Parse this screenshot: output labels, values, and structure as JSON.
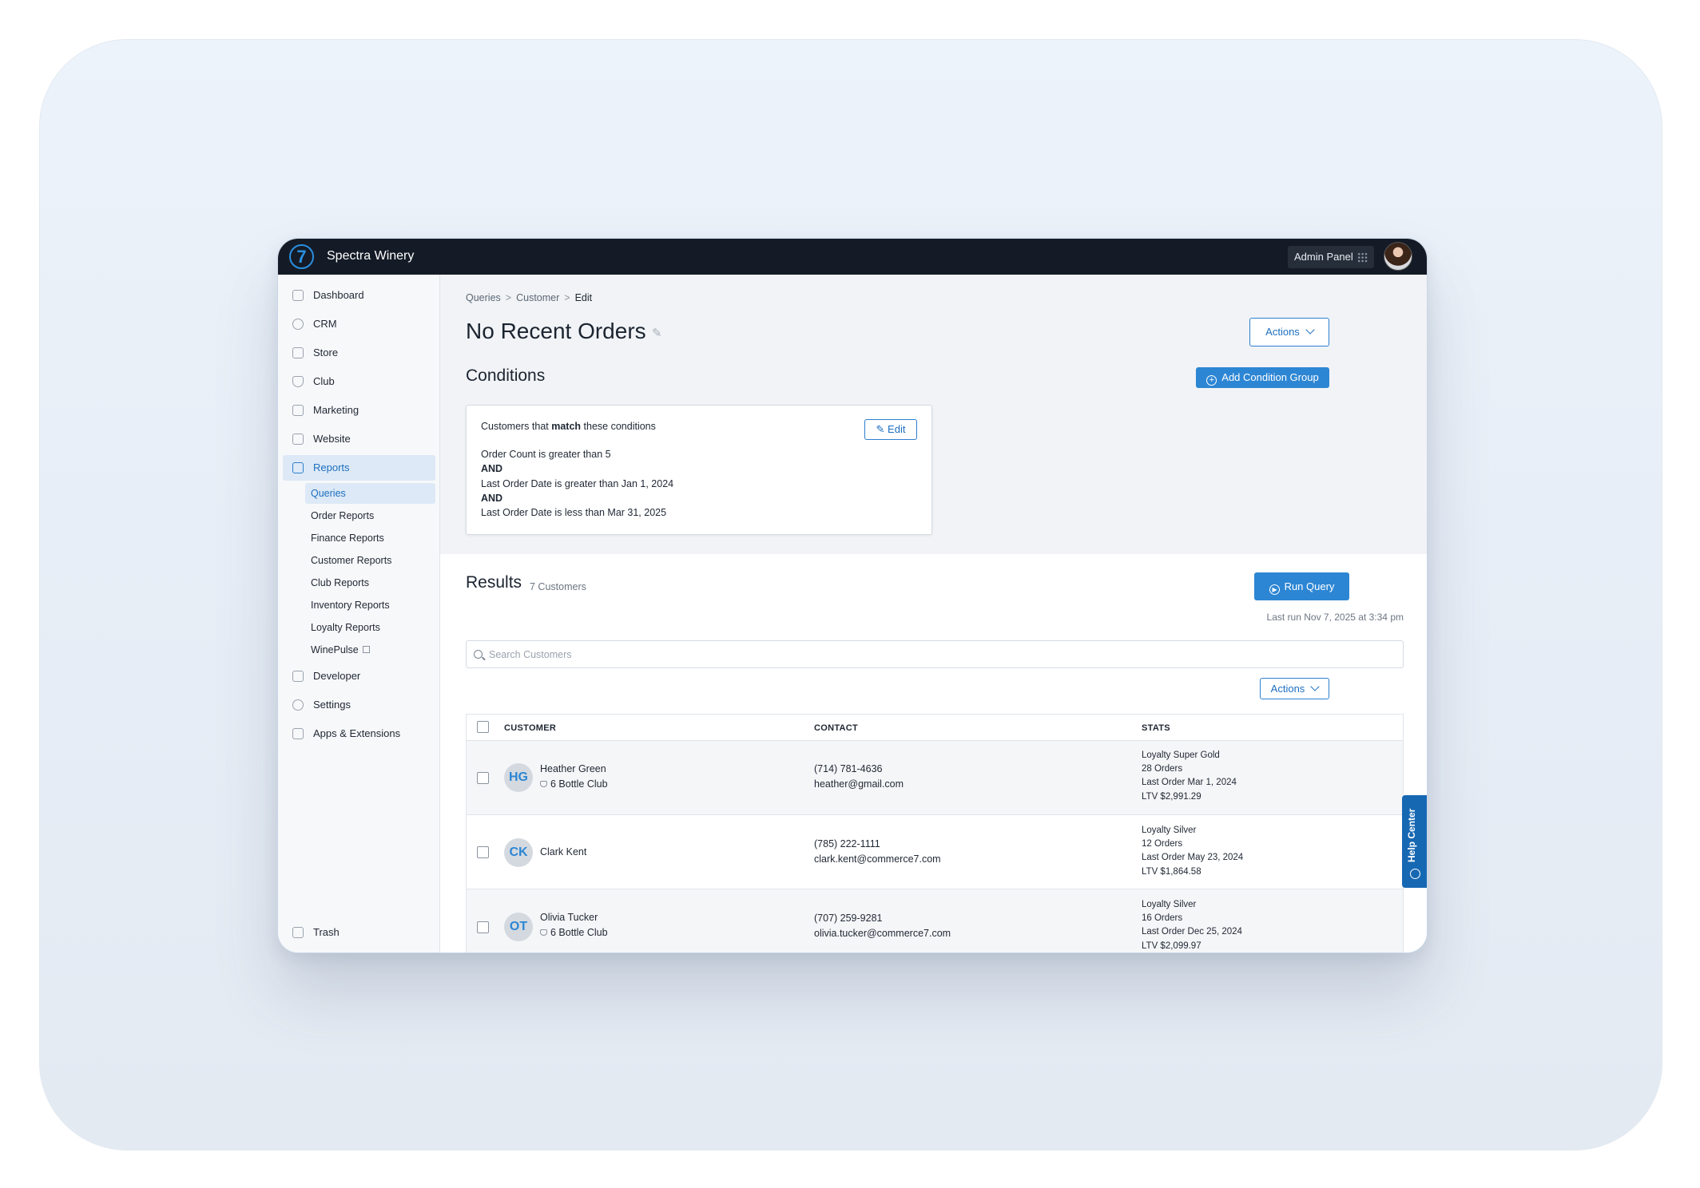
{
  "app": {
    "brand": "Spectra Winery",
    "logo_glyph": "7",
    "admin_label": "Admin Panel",
    "accent": "#2d86d4"
  },
  "sidebar": {
    "items": [
      {
        "label": "Dashboard",
        "icon": "home-icon"
      },
      {
        "label": "CRM",
        "icon": "smiley-icon"
      },
      {
        "label": "Store",
        "icon": "store-icon"
      },
      {
        "label": "Club",
        "icon": "diamond-icon"
      },
      {
        "label": "Marketing",
        "icon": "megaphone-icon"
      },
      {
        "label": "Website",
        "icon": "monitor-icon"
      },
      {
        "label": "Reports",
        "icon": "bar-chart-icon"
      },
      {
        "label": "Developer",
        "icon": "wrench-icon"
      },
      {
        "label": "Settings",
        "icon": "gear-icon"
      },
      {
        "label": "Apps & Extensions",
        "icon": "apps-icon"
      }
    ],
    "sub_items": [
      "Queries",
      "Order Reports",
      "Finance Reports",
      "Customer Reports",
      "Club Reports",
      "Inventory Reports",
      "Loyalty Reports",
      "WinePulse"
    ],
    "trash": "Trash"
  },
  "breadcrumb": [
    "Queries",
    "Customer",
    "Edit"
  ],
  "breadcrumb_sep": ">",
  "page": {
    "title": "No Recent Orders",
    "actions_label": "Actions"
  },
  "conditions": {
    "title": "Conditions",
    "add_group_label": "Add Condition Group",
    "intro_pre": "Customers that ",
    "intro_bold": "match",
    "intro_post": " these conditions",
    "edit_label": "Edit",
    "lines": [
      {
        "text": "Order Count is greater than 5",
        "bold": false
      },
      {
        "text": "AND",
        "bold": true
      },
      {
        "text": "Last Order Date is greater than Jan 1, 2024",
        "bold": false
      },
      {
        "text": "AND",
        "bold": true
      },
      {
        "text": "Last Order Date is less than Mar 31, 2025",
        "bold": false
      }
    ]
  },
  "results": {
    "title": "Results",
    "count": "7 Customers",
    "run_label": "Run Query",
    "last_run": "Last run Nov 7, 2025 at 3:34 pm",
    "search_placeholder": "Search Customers",
    "actions_label": "Actions",
    "columns": [
      "CUSTOMER",
      "CONTACT",
      "STATS"
    ],
    "rows": [
      {
        "initials": "HG",
        "name": "Heather Green",
        "club": "6 Bottle Club",
        "phone": "(714) 781-4636",
        "email": "heather@gmail.com",
        "stats": [
          "Loyalty Super Gold",
          "28 Orders",
          "Last Order Mar 1, 2024",
          "LTV  $2,991.29"
        ]
      },
      {
        "initials": "CK",
        "name": "Clark Kent",
        "club": "",
        "phone": "(785) 222-1111",
        "email": "clark.kent@commerce7.com",
        "stats": [
          "Loyalty Silver",
          "12 Orders",
          "Last Order May 23, 2024",
          "LTV  $1,864.58"
        ]
      },
      {
        "initials": "OT",
        "name": "Olivia Tucker",
        "club": "6 Bottle Club",
        "phone": "(707) 259-9281",
        "email": "olivia.tucker@commerce7.com",
        "stats": [
          "Loyalty Silver",
          "16 Orders",
          "Last Order Dec 25, 2024",
          "LTV  $2,099.97"
        ]
      }
    ]
  },
  "help": {
    "label": "Help Center"
  }
}
